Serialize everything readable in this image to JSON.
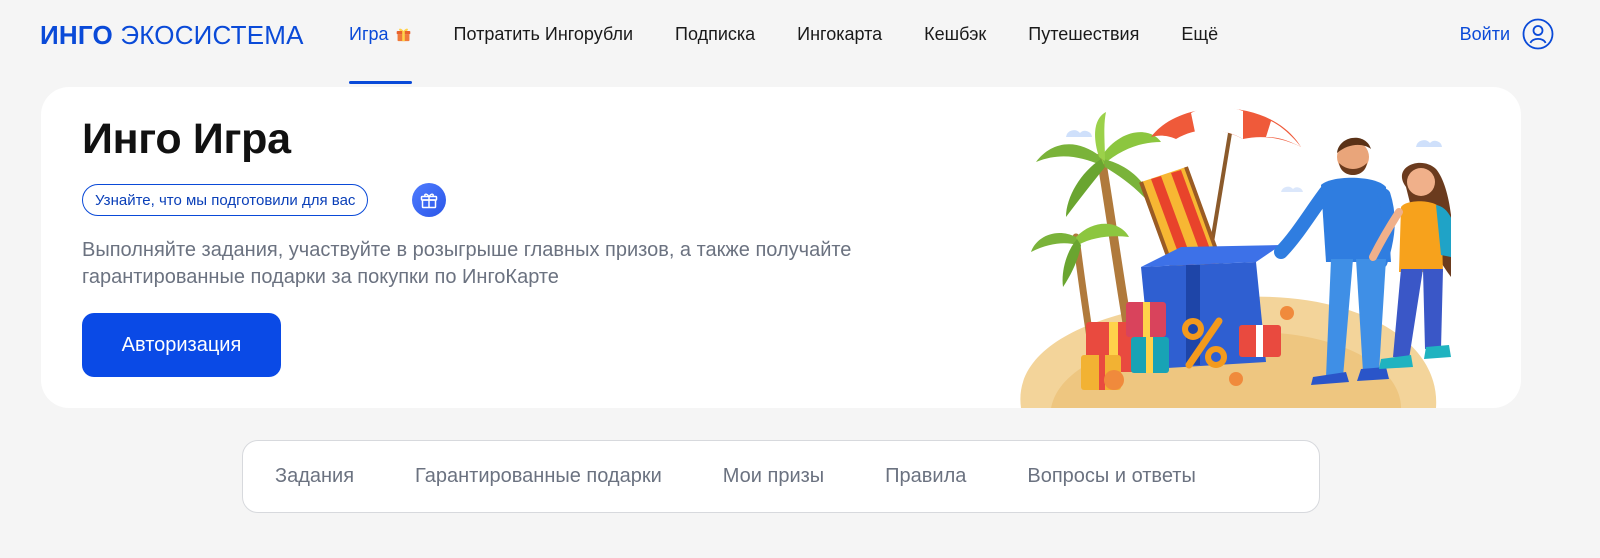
{
  "logo": {
    "bold": "ИНГО",
    "light": "ЭКОСИСТЕМА"
  },
  "nav": {
    "items": [
      {
        "label": "Игра",
        "active": true,
        "icon": "gift-icon"
      },
      {
        "label": "Потратить Ингорубли"
      },
      {
        "label": "Подписка"
      },
      {
        "label": "Ингокарта"
      },
      {
        "label": "Кешбэк"
      },
      {
        "label": "Путешествия"
      },
      {
        "label": "Ещё"
      }
    ],
    "login_label": "Войти",
    "login_icon": "user-icon"
  },
  "hero": {
    "title": "Инго Игра",
    "pill_label": "Узнайте, что мы подготовили для вас",
    "pill_icon": "gift-icon",
    "description": "Выполняйте задания, участвуйте в розыгрыше главных призов, а также получайте гарантированные подарки за покупки по ИнгоКарте",
    "button_label": "Авторизация",
    "illustration": "beach-illustration"
  },
  "tabs": [
    {
      "label": "Задания"
    },
    {
      "label": "Гарантированные подарки"
    },
    {
      "label": "Мои призы"
    },
    {
      "label": "Правила"
    },
    {
      "label": "Вопросы и ответы"
    }
  ],
  "colors": {
    "accent": "#0a4ad8",
    "button": "#0a4ae6",
    "background": "#f5f5f5",
    "muted_text": "#6b7280"
  }
}
